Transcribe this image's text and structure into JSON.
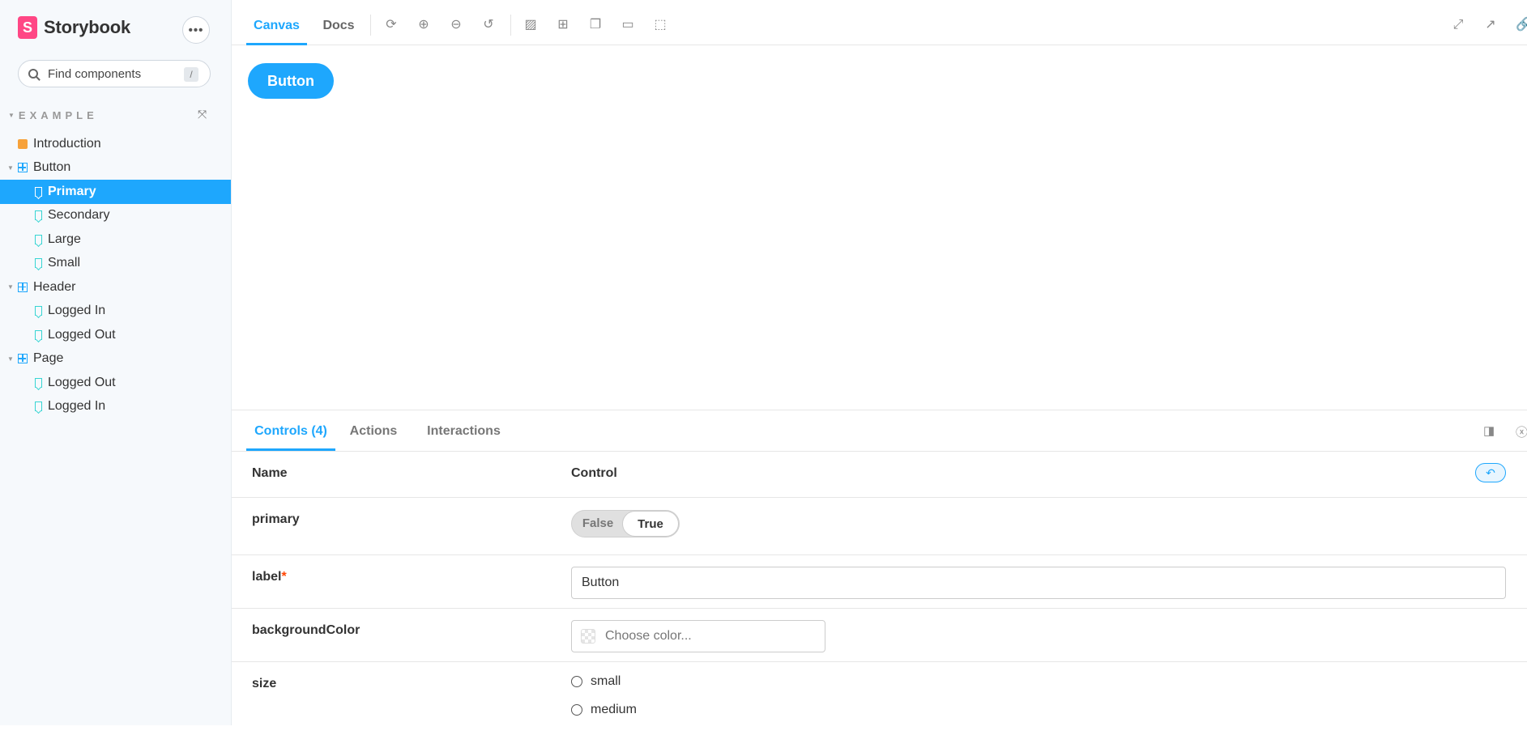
{
  "brand": {
    "name": "Storybook",
    "logo_letter": "S",
    "accent": "#ff4785"
  },
  "sidebar": {
    "search_placeholder": "Find components",
    "search_shortcut": "/",
    "section_title": "EXAMPLE",
    "items": [
      {
        "label": "Introduction",
        "type": "doc"
      },
      {
        "label": "Button",
        "type": "component"
      },
      {
        "label": "Primary",
        "type": "story",
        "selected": true
      },
      {
        "label": "Secondary",
        "type": "story"
      },
      {
        "label": "Large",
        "type": "story"
      },
      {
        "label": "Small",
        "type": "story"
      },
      {
        "label": "Header",
        "type": "component"
      },
      {
        "label": "Logged In",
        "type": "story"
      },
      {
        "label": "Logged Out",
        "type": "story"
      },
      {
        "label": "Page",
        "type": "component"
      },
      {
        "label": "Logged Out",
        "type": "story"
      },
      {
        "label": "Logged In",
        "type": "story"
      }
    ]
  },
  "toolbar": {
    "tabs": [
      {
        "label": "Canvas",
        "active": true
      },
      {
        "label": "Docs"
      }
    ],
    "tools": [
      "reload-icon",
      "zoom-in-icon",
      "zoom-out-icon",
      "zoom-reset-icon",
      "background-icon",
      "grid-icon",
      "viewport-icon",
      "measure-icon",
      "outline-icon"
    ],
    "right_tools": [
      "fullscreen-icon",
      "open-new-tab-icon",
      "copy-link-icon"
    ]
  },
  "canvas": {
    "preview_button_label": "Button",
    "accent": "#1ea7fd"
  },
  "addons": {
    "tabs": [
      {
        "label": "Controls (4)",
        "active": true
      },
      {
        "label": "Actions"
      },
      {
        "label": "Interactions"
      }
    ],
    "headers": {
      "name": "Name",
      "control": "Control"
    },
    "rows": {
      "primary": {
        "name": "primary",
        "false_label": "False",
        "true_label": "True",
        "value": true
      },
      "label": {
        "name": "label",
        "required_mark": "*",
        "value": "Button"
      },
      "backgroundColor": {
        "name": "backgroundColor",
        "placeholder": "Choose color..."
      },
      "size": {
        "name": "size",
        "options": [
          "small",
          "medium"
        ]
      }
    }
  }
}
